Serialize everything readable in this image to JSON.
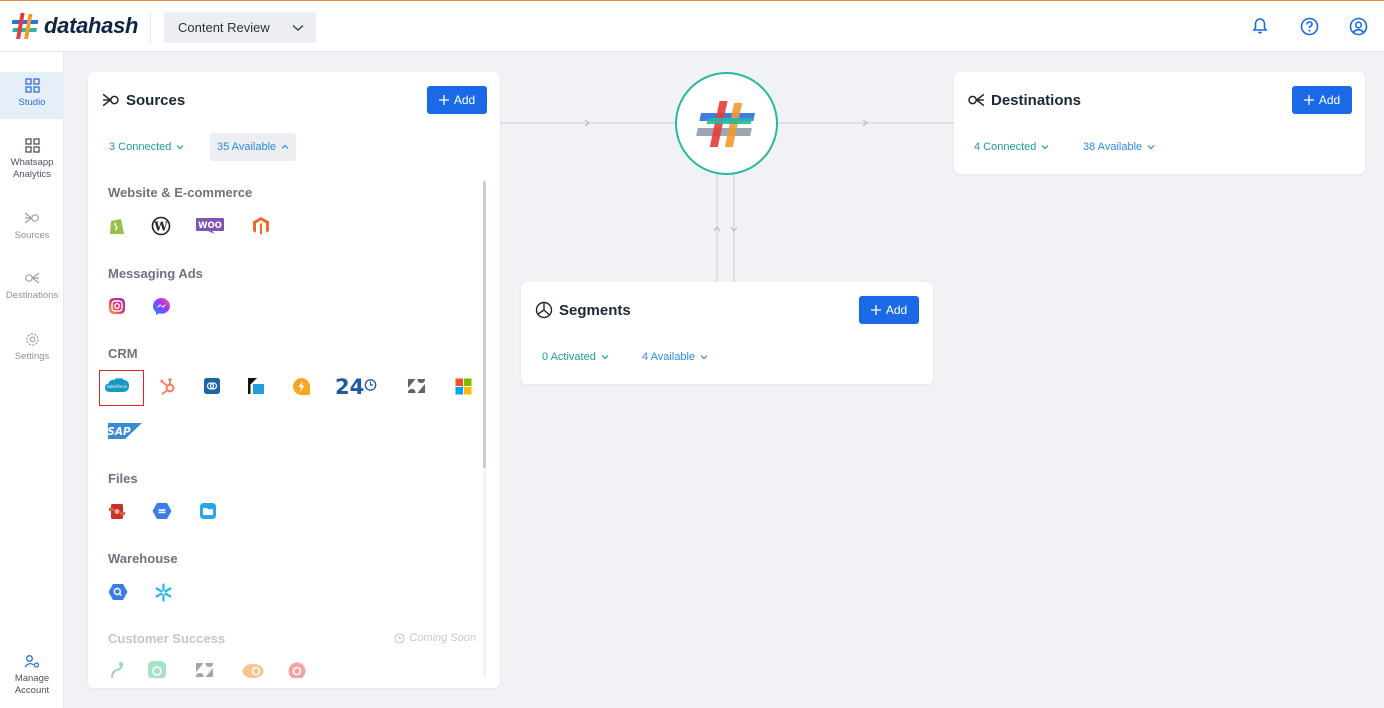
{
  "app": {
    "logo_text": "datahash",
    "workspace": "Content Review"
  },
  "topbar_icons": [
    "bell-icon",
    "help-icon",
    "account-icon"
  ],
  "sidebar": {
    "items": [
      {
        "label": "Studio",
        "icon": "grid-icon",
        "active": true
      },
      {
        "label": "Whatsapp Analytics",
        "icon": "grid-icon",
        "active": false
      },
      {
        "label": "Sources",
        "icon": "sources-icon",
        "active": false
      },
      {
        "label": "Destinations",
        "icon": "destinations-icon",
        "active": false
      },
      {
        "label": "Settings",
        "icon": "gear-icon",
        "active": false
      }
    ],
    "bottom": {
      "label": "Manage Account",
      "icon": "manage-account-icon"
    }
  },
  "sources": {
    "title": "Sources",
    "add_label": "Add",
    "connected": "3 Connected",
    "available": "35 Available",
    "sections": {
      "website": {
        "title": "Website & E-commerce",
        "items": [
          "Shopify",
          "WordPress",
          "WooCommerce",
          "Magento"
        ]
      },
      "messaging": {
        "title": "Messaging Ads",
        "items": [
          "Instagram",
          "Messenger"
        ]
      },
      "crm": {
        "title": "CRM",
        "items": [
          "Salesforce",
          "HubSpot",
          "Zoho",
          "Freshsales",
          "Freshdesk",
          "24",
          "Zendesk",
          "Microsoft",
          "SAP"
        ]
      },
      "files": {
        "title": "Files",
        "items": [
          "FTP",
          "Google Drive",
          "Files"
        ]
      },
      "warehouse": {
        "title": "Warehouse",
        "items": [
          "BigQuery",
          "Snowflake"
        ]
      },
      "customer_success": {
        "title": "Customer Success",
        "badge": "Coming Soon",
        "items": [
          "Gainsight",
          "Totango",
          "Zendesk",
          "ChurnZero",
          "Vitally"
        ]
      }
    }
  },
  "segments": {
    "title": "Segments",
    "add_label": "Add",
    "activated": "0 Activated",
    "available": "4 Available"
  },
  "destinations": {
    "title": "Destinations",
    "add_label": "Add",
    "connected": "4 Connected",
    "available": "38 Available"
  },
  "colors": {
    "primary": "#1a6ae8",
    "teal": "#1d9e96",
    "hub_border": "#27b7a3",
    "top_accent": "#e8893a",
    "highlight": "#e02424"
  }
}
